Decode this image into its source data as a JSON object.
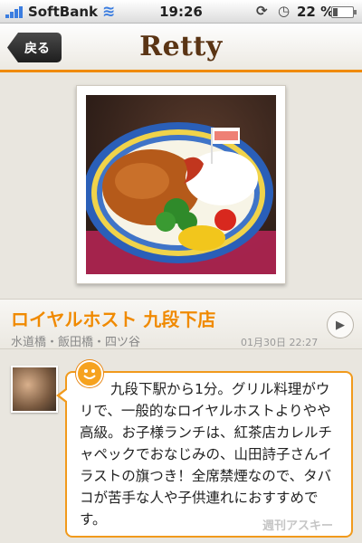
{
  "status_bar": {
    "carrier": "SoftBank",
    "time": "19:26",
    "battery": "22 %",
    "battery_level": 0.22
  },
  "nav": {
    "back_label": "戻る",
    "logo": "Retty",
    "accent_color": "#f08a00"
  },
  "post": {
    "restaurant_name": "ロイヤルホスト 九段下店",
    "area": "水道橋・飯田橋・四ツ谷",
    "datetime": "01月30日 22:27",
    "comment": "九段下駅から1分。グリル料理がウリで、一般的なロイヤルホストよりやや高級。お子様ランチは、紅茶店カレルチャペックでおなじみの、山田詩子さんイラストの旗つき！全席禁煙なので、タバコが苦手な人や子供連れにおすすめです。"
  },
  "watermark": "週刊アスキー",
  "icons": [
    "signal-bars-icon",
    "wifi-icon",
    "rotation-lock-icon",
    "alarm-icon",
    "battery-icon",
    "chevron-right-icon",
    "smiley-icon"
  ]
}
